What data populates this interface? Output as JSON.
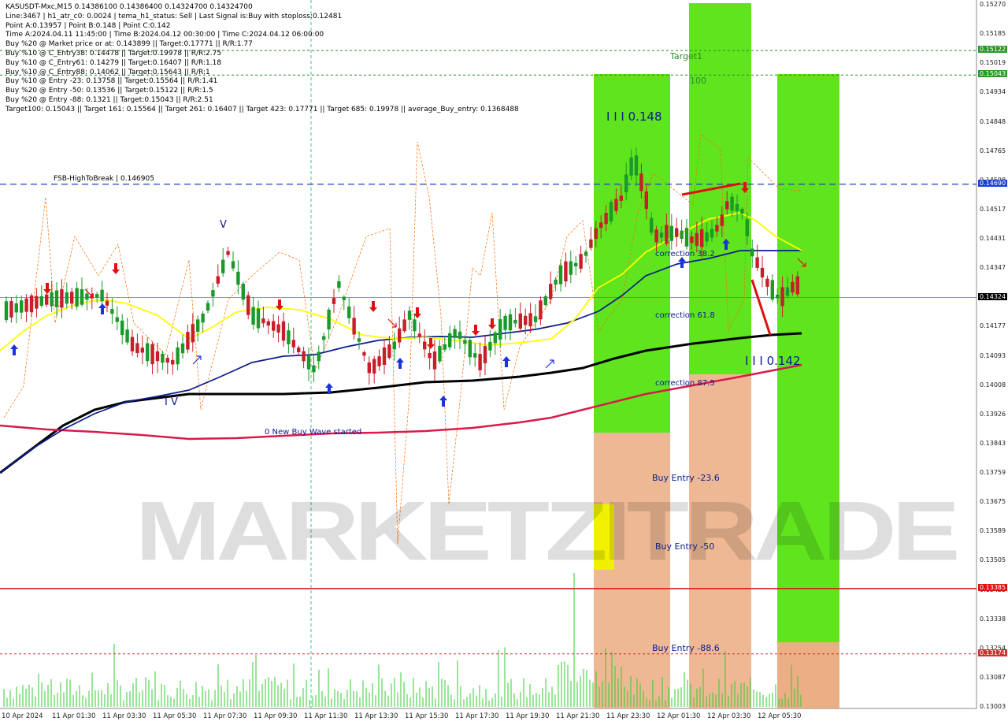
{
  "chart_header": [
    "KASUSDT-Mxc,M15  0.14386100 0.14386400 0.14324700 0.14324700",
    "Line:3467 | h1_atr_c0: 0.0024 | tema_h1_status: Sell | Last Signal is:Buy with stoploss:0.12481",
    "Point A:0.13957 | Point B:0.148 | Point C:0.142",
    "Time A:2024.04.11 11:45:00 | Time B:2024.04.12 00:30:00 | Time C:2024.04.12 06:00:00",
    "Buy %20 @ Market price or at: 0.143899 || Target:0.17771 || R/R:1.77",
    "Buy %10 @ C_Entry38: 0.14478 || Target:0.19978 || R/R:2.75",
    "Buy %10 @ C_Entry61: 0.14279 || Target:0.16407 || R/R:1.18",
    "Buy %10 @ C_Entry88: 0.14062 || Target:0.15643 || R/R:1",
    "Buy %10 @ Entry -23: 0.13758 || Target:0.15564 || R/R:1.41",
    "Buy %20 @ Entry -50: 0.13536 || Target:0.15122 || R/R:1.5",
    "Buy %20 @ Entry -88: 0.1321 || Target:0.15043 || R/R:2.51",
    "Target100: 0.15043 || Target 161: 0.15564 || Target 261: 0.16407 || Target 423: 0.17771 || Target 685: 0.19978 || average_Buy_entry: 0.1368488"
  ],
  "annotations": {
    "fsb": "FSB-HighToBreak | 0.146905",
    "target1": "Target1",
    "t100": "100",
    "point_b": "I I I 0.148",
    "point_c": "I I I 0.142",
    "corr38": "correction 38.2",
    "corr61": "correction 61.8",
    "corr87": "correction 87.5",
    "wave": "0 New Buy Wave started",
    "buy23": "Buy Entry -23.6",
    "buy50": "Buy Entry -50",
    "buy88": "Buy Entry -88.6",
    "iv": "I V",
    "v": "V"
  },
  "watermark": "MARKETZITRADE",
  "price_axis": [
    "0.15270",
    "0.15185",
    "0.15019",
    "0.14934",
    "0.14848",
    "0.14765",
    "0.14598",
    "0.14517",
    "0.14431",
    "0.14347",
    "0.14261",
    "0.14177",
    "0.14093",
    "0.14008",
    "0.13926",
    "0.13843",
    "0.13759",
    "0.13675",
    "0.13589",
    "0.13505",
    "0.13422",
    "0.13338",
    "0.13254",
    "0.13087",
    "0.13003"
  ],
  "price_tags": [
    {
      "text": "0.15122",
      "color": "#2a9a2a"
    },
    {
      "text": "0.15043",
      "color": "#2a9a2a"
    },
    {
      "text": "0.14690",
      "color": "#1a3fd8"
    },
    {
      "text": "0.14324",
      "color": "#000000"
    },
    {
      "text": "0.13385",
      "color": "#e01010"
    },
    {
      "text": "0.13174",
      "color": "#d03030"
    }
  ],
  "time_axis": [
    "10 Apr 2024",
    "11 Apr 01:30",
    "11 Apr 03:30",
    "11 Apr 05:30",
    "11 Apr 07:30",
    "11 Apr 09:30",
    "11 Apr 11:30",
    "11 Apr 13:30",
    "11 Apr 15:30",
    "11 Apr 17:30",
    "11 Apr 19:30",
    "11 Apr 21:30",
    "11 Apr 23:30",
    "12 Apr 01:30",
    "12 Apr 03:30",
    "12 Apr 05:30"
  ],
  "colors": {
    "green_zone": "#5fe41e",
    "orange_zone": "#e8a070",
    "yellow_ma": "#ffff00",
    "blue_ma": "#0b1d8c",
    "black_ma": "#000000",
    "red_ma": "#d81b4a",
    "fsb_line": "#2040c8",
    "stop_line": "#e01010"
  },
  "chart_data": {
    "type": "candlestick",
    "symbol": "KASUSDT-Mxc",
    "timeframe": "M15",
    "ohlc_last": {
      "open": 0.143861,
      "high": 0.143864,
      "low": 0.143247,
      "close": 0.143247
    },
    "levels": {
      "fsb_high_to_break": 0.146905,
      "target1": 0.15122,
      "target100": 0.15043,
      "point_b": 0.148,
      "point_c": 0.142,
      "point_a": 0.13957,
      "stoploss": 0.12481,
      "red_level": 0.13385,
      "lower_level": 0.13174
    },
    "ylim": [
      0.13003,
      0.1527
    ]
  }
}
